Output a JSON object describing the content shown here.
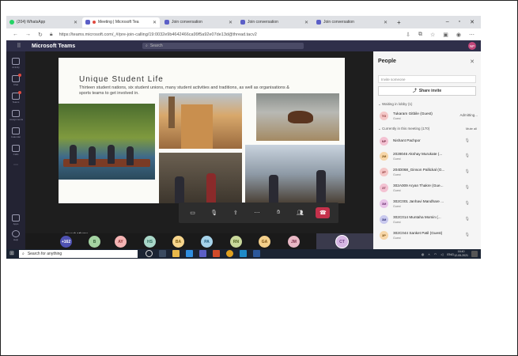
{
  "browser": {
    "tabs": [
      {
        "label": "(204) WhatsApp",
        "color": "#25d366"
      },
      {
        "label": "Meeting | Microsoft Tea",
        "color": "#5b5fc7",
        "active": true
      },
      {
        "label": "Join conversation",
        "color": "#5b5fc7"
      },
      {
        "label": "Join conversation",
        "color": "#5b5fc7"
      },
      {
        "label": "Join conversation",
        "color": "#5b5fc7"
      }
    ],
    "new_tab": "+",
    "url": "https://teams.microsoft.com/_#/pre-join-calling/19:0032e9b4642466ca99f5a92e07de13d@thread.tacv2"
  },
  "teams": {
    "brand": "Microsoft Teams",
    "search_placeholder": "Search",
    "user_initials": "NP",
    "rail": [
      "Activity",
      "Chat",
      "Teams",
      "Assignments",
      "Calendar",
      "Calls",
      "Apps",
      "Help"
    ]
  },
  "slide": {
    "title": "Unique Student Life",
    "subtitle": "Thirteen student nations, six student unions, many student activities and traditions, as well as organisations & sports teams to get involved in."
  },
  "presenter_name": "Jayesh Mhatre",
  "participants_strip": [
    {
      "label": "+162",
      "color": "#4f52b2"
    },
    {
      "label": "B",
      "color": "#a4d3a2"
    },
    {
      "label": "AY",
      "color": "#f4b3b3"
    },
    {
      "label": "HS",
      "color": "#a9d7c8"
    },
    {
      "label": "BA",
      "color": "#f7d58c"
    },
    {
      "label": "PA",
      "color": "#a6d3ea"
    },
    {
      "label": "RN",
      "color": "#c9d89b"
    },
    {
      "label": "GA",
      "color": "#f3cf8a"
    },
    {
      "label": "JM",
      "color": "#e9b8c5"
    }
  ],
  "active_speaker": {
    "initials": "CT",
    "name": "Cecilia Tocornle"
  },
  "people_panel": {
    "title": "People",
    "invite_placeholder": "Invite someone",
    "share_invite": "Share invite",
    "waiting_header": "Waiting in lobby (1)",
    "meeting_header": "Currently in this meeting (170)",
    "mute_all": "Mute all",
    "lobby": [
      {
        "initials": "TG",
        "name": "Tukaram Gitbile (Guest)",
        "role": "Guest",
        "extra": "Admitting...",
        "color": "#f4c7c7"
      }
    ],
    "members": [
      {
        "initials": "NP",
        "name": "Nishant Pachpor",
        "role": "",
        "color": "#f3c2d2"
      },
      {
        "initials": "2M",
        "name": "2028046 Akshay Murukate (...",
        "role": "Guest",
        "color": "#f7d6a8"
      },
      {
        "initials": "2P",
        "name": "204D068_Ginson Pallickal (G...",
        "role": "Guest",
        "color": "#f4c7c7"
      },
      {
        "initials": "3T",
        "name": "302A009 Aryan Thakre (Gue...",
        "role": "Guest",
        "color": "#f3c2d2"
      },
      {
        "initials": "3M",
        "name": "302C001 Janhavi Mandhare ...",
        "role": "Guest",
        "color": "#e8c3e8"
      },
      {
        "initials": "3M",
        "name": "302C014 Muntaha Momin (...",
        "role": "Guest",
        "color": "#c9c9ee"
      },
      {
        "initials": "3P",
        "name": "302C044 Sanket Patil (Guest)",
        "role": "Guest",
        "color": "#f7d6a8"
      }
    ]
  },
  "taskbar": {
    "search_placeholder": "Search for anything",
    "tray": "ENG",
    "time": "16:40",
    "date": "12-05-2021"
  }
}
